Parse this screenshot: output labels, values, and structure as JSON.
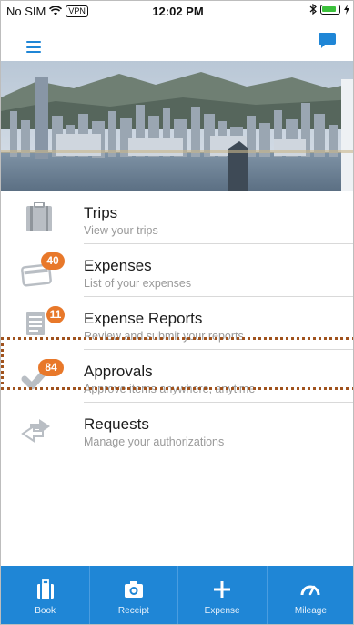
{
  "status_bar": {
    "carrier": "No SIM",
    "vpn": "VPN",
    "time": "12:02 PM"
  },
  "nav": {
    "menu_icon": "hamburger-menu-icon",
    "chat_icon": "chat-bubble-icon",
    "accent": "#1f86d6"
  },
  "menu": {
    "items": [
      {
        "title": "Trips",
        "subtitle": "View your trips",
        "icon": "briefcase-icon",
        "badge": ""
      },
      {
        "title": "Expenses",
        "subtitle": "List of your expenses",
        "icon": "credit-card-icon",
        "badge": "40"
      },
      {
        "title": "Expense Reports",
        "subtitle": "Review and submit your reports",
        "icon": "report-icon",
        "badge": "11"
      },
      {
        "title": "Approvals",
        "subtitle": "Approve items anywhere, anytime",
        "icon": "checkmark-icon",
        "badge": "84"
      },
      {
        "title": "Requests",
        "subtitle": "Manage your authorizations",
        "icon": "arrows-exchange-icon",
        "badge": ""
      }
    ],
    "badge_color": "#e8782a",
    "highlight_color": "#a0521d"
  },
  "tab_bar": {
    "tabs": [
      {
        "label": "Book",
        "icon": "briefcase-icon"
      },
      {
        "label": "Receipt",
        "icon": "camera-icon"
      },
      {
        "label": "Expense",
        "icon": "plus-icon"
      },
      {
        "label": "Mileage",
        "icon": "gauge-icon"
      }
    ],
    "background": "#1f86d6"
  }
}
